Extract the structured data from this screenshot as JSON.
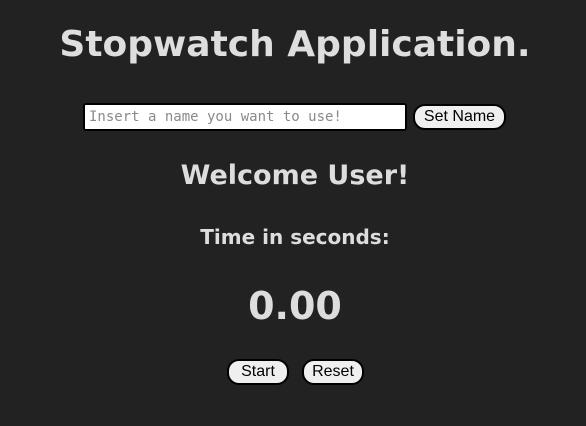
{
  "app": {
    "title": "Stopwatch Application."
  },
  "name_form": {
    "input_value": "",
    "input_placeholder": "Insert a name you want to use!",
    "set_name_label": "Set Name"
  },
  "greeting": {
    "text": "Welcome User!"
  },
  "timer": {
    "label": "Time in seconds:",
    "value": "0.00"
  },
  "controls": {
    "start_label": "Start",
    "reset_label": "Reset"
  },
  "colors": {
    "background": "#222222",
    "text": "#dddddd",
    "button_bg": "#efefef",
    "input_bg": "#ffffff"
  }
}
